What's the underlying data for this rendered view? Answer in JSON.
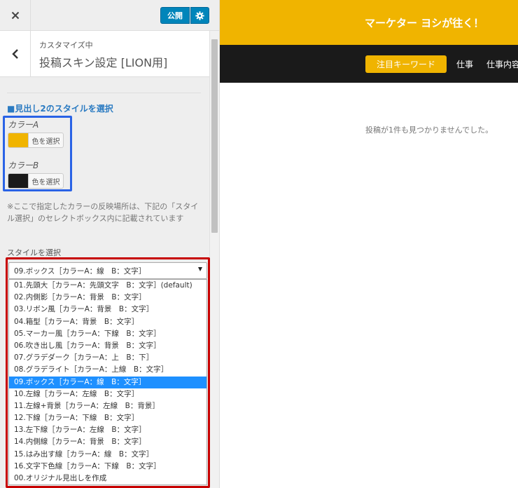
{
  "topbar": {
    "publish_label": "公開"
  },
  "section": {
    "kicker": "カスタマイズ中",
    "title": "投稿スキン設定 [LION用]"
  },
  "h2_style": {
    "heading": "■見出し2のスタイルを選択",
    "color_a": {
      "label": "カラーA",
      "button": "色を選択",
      "value": "#f0b400"
    },
    "color_b": {
      "label": "カラーB",
      "button": "色を選択",
      "value": "#1a1a1a"
    },
    "note": "※ここで指定したカラーの反映場所は、下記の「スタイル選択」のセレクトボックス内に記載されています",
    "style_label": "スタイルを選択",
    "selected": "09.ボックス［カラーA：線　B：文字］",
    "options": [
      "01.先頭大［カラーA：先頭文字　B：文字］(default)",
      "02.内側影［カラーA：背景　B：文字］",
      "03.リボン風［カラーA：背景　B：文字］",
      "04.箱型［カラーA：背景　B：文字］",
      "05.マーカー風［カラーA：下線　B：文字］",
      "06.吹き出し風［カラーA：背景　B：文字］",
      "07.グラデダーク［カラーA：上　B：下］",
      "08.グラデライト［カラーA：上線　B：文字］",
      "09.ボックス［カラーA：線　B：文字］",
      "10.左線［カラーA：左線　B：文字］",
      "11.左線+背景［カラーA：左線　B：背景］",
      "12.下線［カラーA：下線　B：文字］",
      "13.左下線［カラーA：左線　B：文字］",
      "14.内側線［カラーA：背景　B：文字］",
      "15.はみ出す線［カラーA：線　B：文字］",
      "16.文字下色線［カラーA：下線　B：文字］",
      "00.オリジナル見出しを作成"
    ],
    "selected_index": 8
  },
  "preview": {
    "site_title": "マーケター ヨシが往く！",
    "nav": {
      "keyword": "注目キーワード",
      "item1": "仕事",
      "item2": "仕事内容"
    },
    "no_posts": "投稿が1件も見つかりませんでした。"
  },
  "colors": {
    "accent": "#0085ba",
    "highlight": "#1e90ff",
    "brand_yellow": "#f0b400",
    "dark": "#1a1a1a",
    "box_blue": "#2a63e6",
    "box_red": "#c70000"
  }
}
